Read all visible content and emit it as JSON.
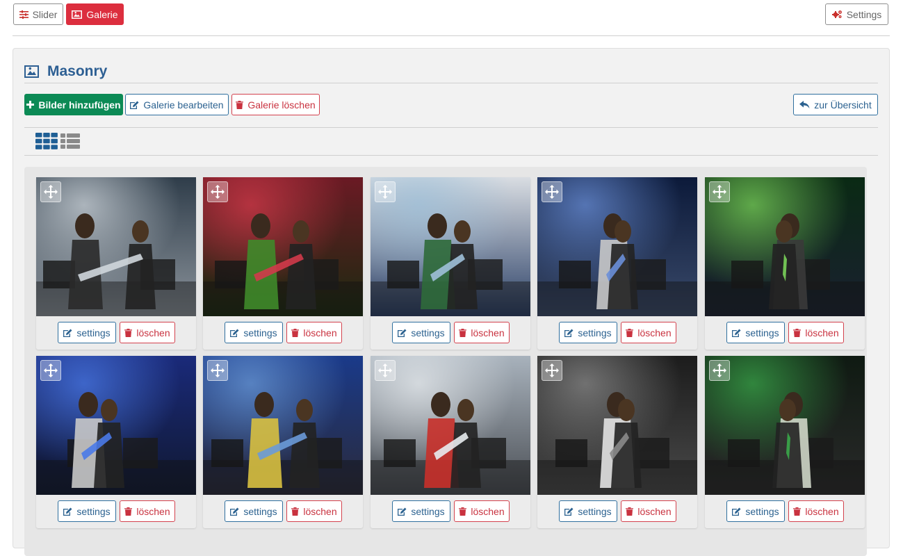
{
  "topbar": {
    "tabs": [
      {
        "label": "Slider",
        "icon": "sliders-icon",
        "active": false
      },
      {
        "label": "Galerie",
        "icon": "image-icon",
        "active": true
      }
    ],
    "settings_label": "Settings"
  },
  "panel": {
    "title": "Masonry",
    "title_icon": "image-icon",
    "actions": {
      "add_images": "Bilder hinzufügen",
      "edit_gallery": "Galerie bearbeiten",
      "delete_gallery": "Galerie löschen",
      "overview": "zur Übersicht"
    },
    "view_modes": [
      "grid",
      "list"
    ]
  },
  "gallery": {
    "items": [
      {
        "settings": "settings",
        "delete": "löschen"
      },
      {
        "settings": "settings",
        "delete": "löschen"
      },
      {
        "settings": "settings",
        "delete": "löschen"
      },
      {
        "settings": "settings",
        "delete": "löschen"
      },
      {
        "settings": "settings",
        "delete": "löschen"
      },
      {
        "settings": "settings",
        "delete": "löschen"
      },
      {
        "settings": "settings",
        "delete": "löschen"
      },
      {
        "settings": "settings",
        "delete": "löschen"
      },
      {
        "settings": "settings",
        "delete": "löschen"
      },
      {
        "settings": "settings",
        "delete": "löschen"
      }
    ]
  },
  "colors": {
    "primary_blue": "#2c6290",
    "danger_red": "#dc2e3e",
    "success_green": "#0c8a55",
    "title_blue": "#2d5f93"
  }
}
